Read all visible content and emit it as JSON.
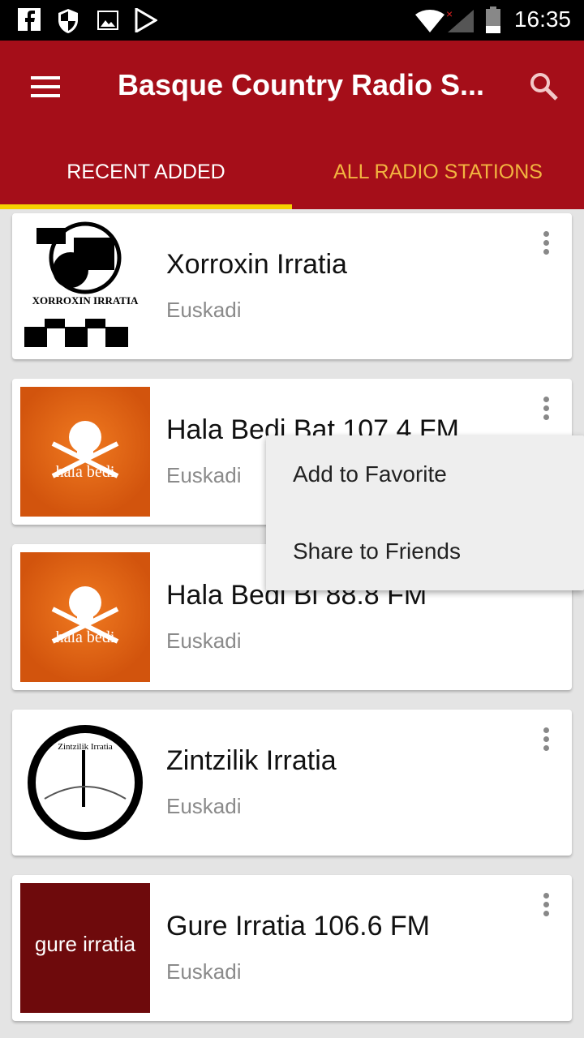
{
  "status_bar": {
    "time": "16:35",
    "icons": [
      "facebook-icon",
      "shield-icon",
      "image-icon",
      "play-store-icon",
      "wifi-icon",
      "signal-icon",
      "battery-icon"
    ]
  },
  "app_bar": {
    "title": "Basque Country Radio S...",
    "menu_icon": "hamburger-icon",
    "search_icon": "search-icon"
  },
  "tabs": [
    {
      "label": "RECENT ADDED",
      "active": true
    },
    {
      "label": "ALL RADIO STATIONS",
      "active": false
    }
  ],
  "colors": {
    "primary": "#a50e19",
    "indicator": "#f5d100",
    "inactive_tab": "#f2b440"
  },
  "stations": [
    {
      "name": "Xorroxin Irratia",
      "region": "Euskadi",
      "logo_text": "XORROXIN IRRATIA"
    },
    {
      "name": "Hala Bedi Bat 107.4 FM",
      "region": "Euskadi",
      "logo_text": "hala bedi"
    },
    {
      "name": "Hala Bedi Bi 88.8 FM",
      "region": "Euskadi",
      "logo_text": "hala bedi"
    },
    {
      "name": "Zintzilik Irratia",
      "region": "Euskadi",
      "logo_text": "Zintzilik Irratia"
    },
    {
      "name": "Gure Irratia 106.6 FM",
      "region": "Euskadi",
      "logo_text": "gure irratia"
    }
  ],
  "context_menu": {
    "items": [
      "Add to Favorite",
      "Share to Friends"
    ]
  }
}
